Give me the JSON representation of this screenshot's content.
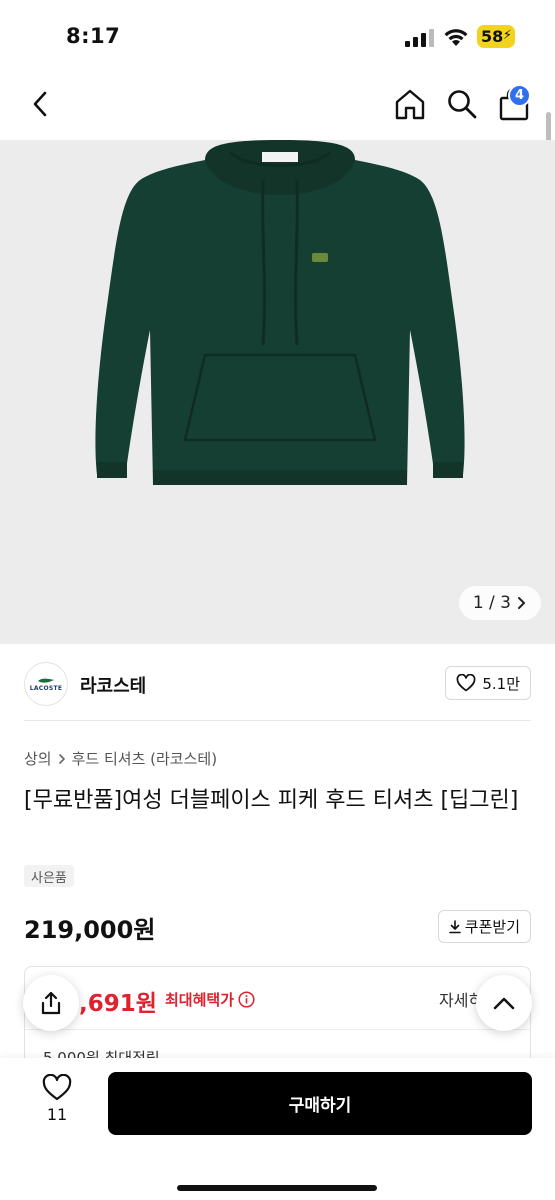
{
  "status_bar": {
    "time": "8:17",
    "battery": "58"
  },
  "nav": {
    "cart_count": "4"
  },
  "hero": {
    "image_counter": "1 / 3"
  },
  "brand": {
    "logo_text": "LACOSTE",
    "name": "라코스테",
    "likes": "5.1만"
  },
  "breadcrumb": {
    "category": "상의",
    "subcategory": "후드 티셔츠 (라코스테)"
  },
  "product": {
    "title": "[무료반품]여성 더블페이스 피케 후드 티셔츠 [딥그린]",
    "tag": "사은품",
    "price": "219,000원",
    "coupon_label": "쿠폰받기"
  },
  "benefit": {
    "price": "4,691원",
    "label": "최대혜택가",
    "detail": "자세히",
    "sub": "5,000원 최대적립"
  },
  "bottom": {
    "wish_count": "11",
    "buy_label": "구매하기"
  },
  "colors": {
    "accent_red": "#e0222f",
    "badge_blue": "#2f6ff0",
    "hoodie_green": "#163f34",
    "buy_button": "#000000"
  },
  "icons": [
    "back-icon",
    "home-icon",
    "search-icon",
    "cart-icon",
    "chevron-right-icon",
    "heart-icon",
    "download-icon",
    "info-icon",
    "share-icon",
    "chevron-up-icon"
  ]
}
